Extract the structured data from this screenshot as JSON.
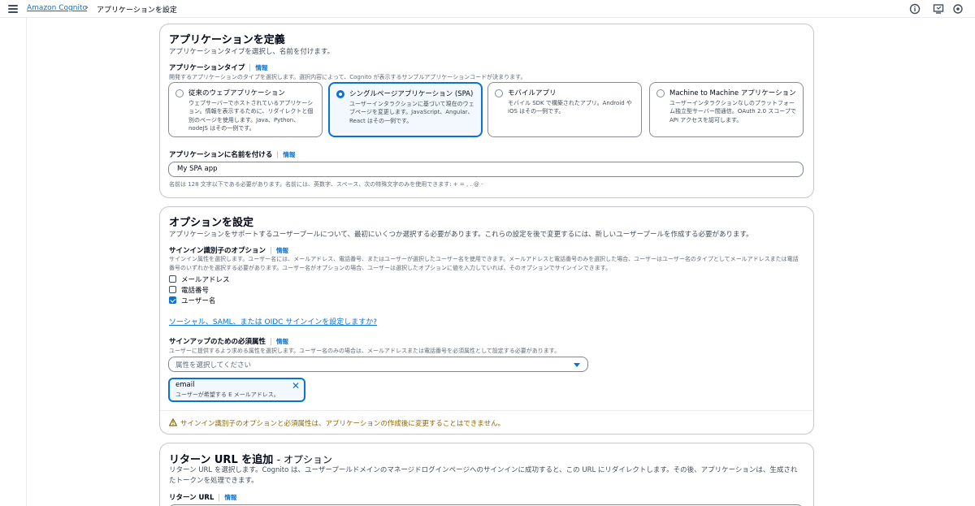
{
  "header": {
    "menu_icon": "hamburger-menu-icon",
    "breadcrumb_service": "Amazon Cognito",
    "breadcrumb_separator": "›",
    "breadcrumb_current": "アプリケーションを設定",
    "right_icons": [
      "info-circle-icon",
      "feedback-icon",
      "settings-icon"
    ]
  },
  "app_panel": {
    "title": "アプリケーションを定義",
    "description": "アプリケーションタイプを選択し、名前を付けます。",
    "type_label": "アプリケーションタイプ",
    "info_label": "情報",
    "type_description": "開発するアプリケーションのタイプを選択します。選択内容によって、Cognito が表示するサンプルアプリケーションコードが決まります。",
    "tiles": [
      {
        "title": "従来のウェブアプリケーション",
        "desc": "ウェブサーバーでホストされているアプリケーション。情報を表示するために、リダイレクトと個別のページを使用します。Java、Python、nodeJS はその一例です。",
        "selected": false
      },
      {
        "title": "シングルページアプリケーション (SPA)",
        "desc": "ユーザーインタラクションに基づいて現在のウェブページを変更します。JavaScript、Angular、React はその一例です。",
        "selected": true
      },
      {
        "title": "モバイルアプリ",
        "desc": "モバイル SDK で構築されたアプリ。Android や iOS はその一例です。",
        "selected": false
      },
      {
        "title": "Machine to Machine アプリケーション",
        "desc": "ユーザーインタラクションなしのプラットフォーム独立型サーバー間通信。OAuth 2.0 スコープで API アクセスを認可します。",
        "selected": false
      }
    ],
    "name_label": "アプリケーションに名前を付ける",
    "name_value": "My SPA app",
    "name_constraint": "名前は 128 文字以下である必要があります。名前には、英数字、スペース、次の特殊文字のみを使用できます: + = , . @ -"
  },
  "options_panel": {
    "title": "オプションを設定",
    "description": "アプリケーションをサポートするユーザープールについて、最初にいくつか選択する必要があります。これらの設定を後で変更するには、新しいユーザープールを作成する必要があります。",
    "signin_label": "サインイン識別子のオプション",
    "info_label": "情報",
    "signin_description": "サインイン属性を選択します。ユーザー名には、メールアドレス、電話番号、またはユーザーが選択したユーザー名を使用できます。メールアドレスと電話番号のみを選択した場合、ユーザーはユーザー名のタイプとしてメールアドレスまたは電話番号のいずれかを選択する必要があります。ユーザー名がオプションの場合、ユーザーは選択したオプションに値を入力していれば、そのオプションでサインインできます。",
    "checkboxes": [
      {
        "label": "メールアドレス",
        "checked": false
      },
      {
        "label": "電話番号",
        "checked": false
      },
      {
        "label": "ユーザー名",
        "checked": true
      }
    ],
    "external_link": "ソーシャル、SAML、または OIDC サインインを設定しますか?",
    "signup_label": "サインアップのための必須属性",
    "signup_description": "ユーザーに提供するよう求める属性を選択します。ユーザー名のみの場合は、メールアドレスまたは電話番号を必須属性として設定する必要があります。",
    "select_placeholder": "属性を選択してください",
    "token": {
      "name": "email",
      "desc": "ユーザーが希望する E メールアドレス。"
    },
    "warning": "サインイン識別子のオプションと必須属性は、アプリケーションの作成後に変更することはできません。",
    "warning_color": "#8d6605"
  },
  "return_panel": {
    "title": "リターン URL を追加",
    "title_suffix": "- オプション",
    "description": "リターン URL を選択します。Cognito は、ユーザープールドメインのマネージドログインページへのサインインに成功すると、この URL にリダイレクトします。その後、アプリケーションは、生成されたトークンを処理できます。",
    "url_label": "リターン URL",
    "info_label": "情報"
  },
  "colors": {
    "accent": "#0972d3",
    "selected_bg": "#f2f8fd",
    "border": "#c6c6cd"
  }
}
